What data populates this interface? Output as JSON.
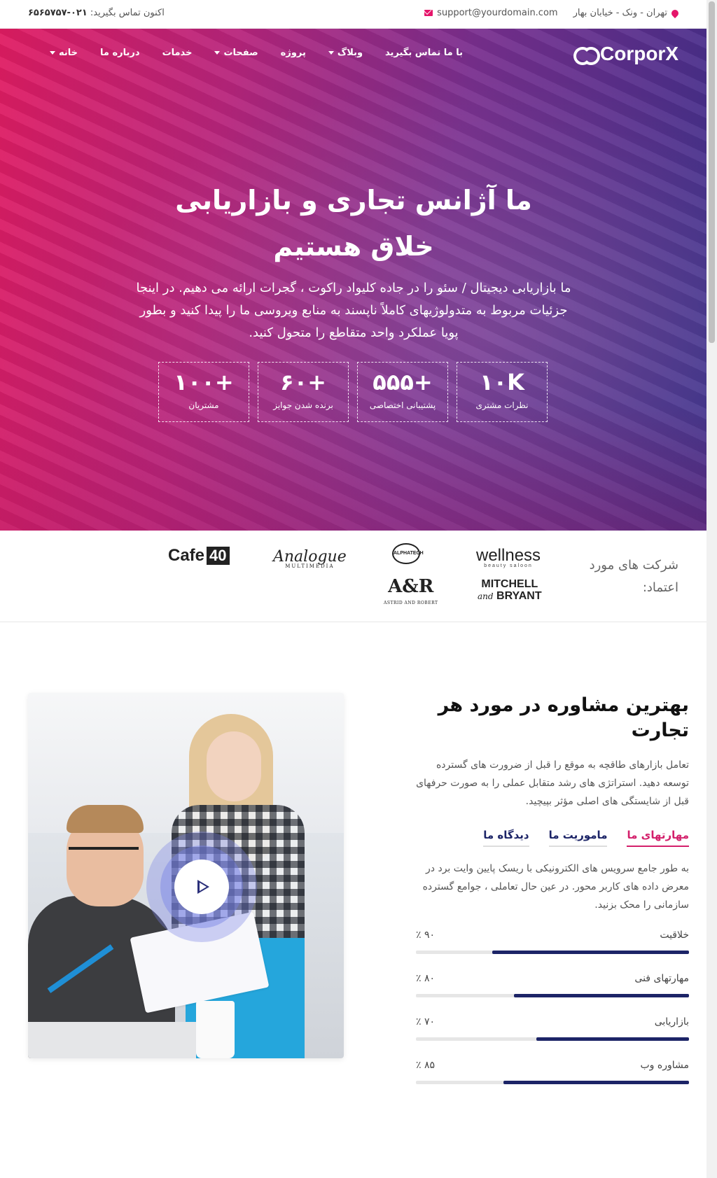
{
  "topbar": {
    "phone_label": "اکنون تماس بگیرید:",
    "phone_number": "۰۲۱-۶۵۶۵۷۵۷",
    "address": "تهران - ونک - خیابان بهار",
    "email": "support@yourdomain.com"
  },
  "nav": {
    "logo_text": "CorporX",
    "items": [
      {
        "label": "خانه",
        "dropdown": true
      },
      {
        "label": "درباره ما",
        "dropdown": false
      },
      {
        "label": "خدمات",
        "dropdown": false
      },
      {
        "label": "صفحات",
        "dropdown": true
      },
      {
        "label": "پروژه",
        "dropdown": false
      },
      {
        "label": "وبلاگ",
        "dropdown": true
      },
      {
        "label": "با ما تماس بگیرید",
        "dropdown": false
      }
    ]
  },
  "hero": {
    "title": "ما آژانس تجاری و بازاریابی خلاق هستیم",
    "description": "ما بازاریابی دیجیتال / سئو را در جاده کلیواد راکوت ، گجرات ارائه می دهیم. در اینجا جزئیات مربوط به متدولوژیهای کاملاً ناپسند به منابع ویروسی ما را پیدا کنید و بطور پویا عملکرد واحد متقاطع را متحول کنید.",
    "stats": [
      {
        "value": "+۱۰۰",
        "label": "مشتریان"
      },
      {
        "value": "+۶۰",
        "label": "برنده شدن جوایز"
      },
      {
        "value": "+۵۵۵",
        "label": "پشتیبانی اختصاصی"
      },
      {
        "value": "۱۰K",
        "label": "نظرات مشتری"
      }
    ]
  },
  "trusted": {
    "label": "شرکت های مورد اعتماد:",
    "brands": {
      "wellness": "wellness",
      "wellness_sub": "beauty saloon",
      "alphatech": "ALPHATECH",
      "analogue": "Analogue",
      "analogue_sub": "MULTIMEDIA",
      "cafe": "Cafe",
      "cafe_num": "40",
      "mitchell_1": "MITCHELL",
      "mitchell_and": "and",
      "mitchell_2": "BRYANT",
      "ar": "A&R",
      "ar_sub": "ASTRID AND ROBERT"
    }
  },
  "consulting": {
    "title": "بهترین مشاوره در مورد هر تجارت",
    "description": "تعامل بازارهای طاقچه به موقع را قبل از ضرورت های گسترده توسعه دهید. استراتژی های رشد متقابل عملی را به صورت حرفهای قبل از شایستگی های اصلی مؤثر بپیچید.",
    "tabs": [
      {
        "label": "مهارتهای ما",
        "active": true
      },
      {
        "label": "ماموریت ما",
        "active": false
      },
      {
        "label": "دیدگاه ما",
        "active": false
      }
    ],
    "tab_text": "به طور جامع سرویس های الکترونیکی با ریسک پایین وایت برد در معرض داده های کاربر محور. در عین حال تعاملی ، جوامع گسترده سازمانی را محک بزنید.",
    "skills": [
      {
        "name": "خلاقیت",
        "pct_label": "۹۰ ٪",
        "value": 0.72
      },
      {
        "name": "مهارتهای فنی",
        "pct_label": "۸۰ ٪",
        "value": 0.64
      },
      {
        "name": "بازاریابی",
        "pct_label": "۷۰ ٪",
        "value": 0.56
      },
      {
        "name": "مشاوره وب",
        "pct_label": "۸۵ ٪",
        "value": 0.68
      }
    ]
  },
  "colors": {
    "accent": "#e5156a",
    "navy": "#1c2467"
  }
}
